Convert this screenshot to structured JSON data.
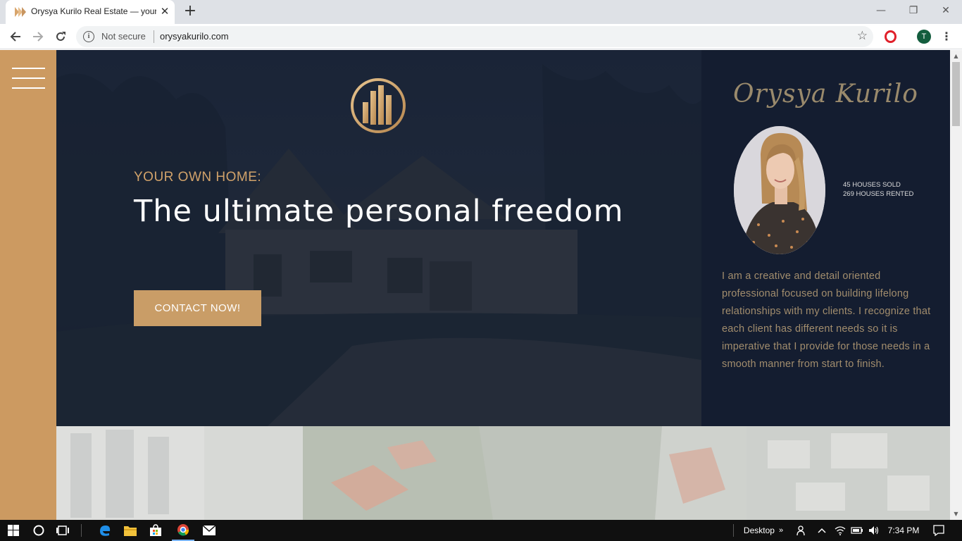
{
  "browser": {
    "tab_title": "Orysya Kurilo Real Estate — your",
    "tab_close": "✕",
    "new_tab": "+",
    "window_controls": {
      "minimize": "—",
      "restore": "❐",
      "close": "✕"
    },
    "security_label": "Not secure",
    "url": "orysyakurilo.com",
    "profile_initial": "T",
    "menu": "⋮",
    "star": "☆"
  },
  "hero": {
    "eyebrow": "YOUR OWN HOME:",
    "headline": "The ultimate personal freedom",
    "cta_label": "CONTACT NOW!"
  },
  "profile": {
    "name": "Orysya Kurilo",
    "stats": [
      "45 HOUSES SOLD",
      "269 HOUSES RENTED"
    ],
    "bio": "I am a creative and detail oriented professional focused on building lifelong relationships with my clients. I recognize that each client has different needs so it is imperative that I provide for those needs in a smooth manner from start to finish."
  },
  "colors": {
    "accent_gold": "#cc9a61",
    "hero_navy": "#1f2839",
    "profile_navy": "#141d30",
    "name_color": "#9a8a6c"
  },
  "taskbar": {
    "desktop_label": "Desktop",
    "time": "7:34 PM",
    "icons": [
      "windows-start-icon",
      "cortana-icon",
      "task-view-icon",
      "edge-icon",
      "file-explorer-icon",
      "store-icon",
      "chrome-icon",
      "mail-icon"
    ]
  }
}
